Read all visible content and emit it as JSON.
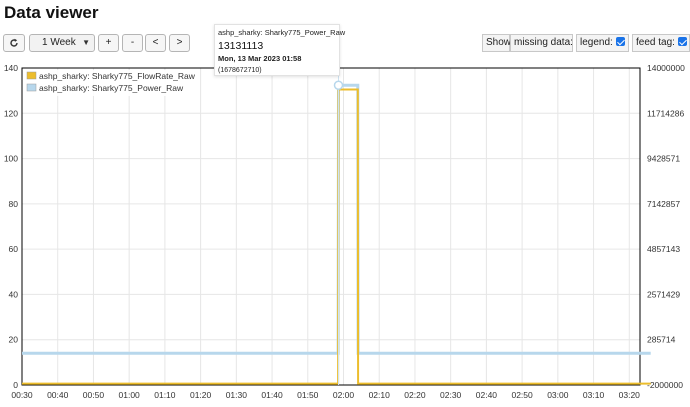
{
  "page": {
    "title": "Data viewer"
  },
  "toolbar": {
    "refresh_icon": "refresh-icon",
    "range_select": {
      "value": "1 Week"
    },
    "zoom_in_label": "+",
    "zoom_out_label": "-",
    "prev_label": "<",
    "next_label": ">"
  },
  "options": {
    "show_label": "Show",
    "missing_data_label": "missing data:",
    "missing_data_checked": false,
    "legend_label": "legend:",
    "legend_checked": true,
    "feed_tag_label": "feed tag:",
    "feed_tag_checked": true
  },
  "tooltip": {
    "series": "ashp_sharky: Sharky775_Power_Raw",
    "value": "13131113",
    "date": "Mon, 13 Mar 2023 01:58",
    "timestamp": "(1678672710)"
  },
  "colors": {
    "flow": "#ecbd2c",
    "power": "#b7d7ec",
    "grid": "#e6e6e6",
    "marker": "#b7d7ec"
  },
  "chart_data": {
    "type": "line",
    "x_ticks": [
      "00:30",
      "00:40",
      "00:50",
      "01:00",
      "01:10",
      "01:20",
      "01:30",
      "01:40",
      "01:50",
      "02:00",
      "02:10",
      "02:20",
      "02:30",
      "02:40",
      "02:50",
      "03:00",
      "03:10",
      "03:20"
    ],
    "y_left_ticks": [
      "0",
      "20",
      "40",
      "60",
      "80",
      "100",
      "120",
      "140"
    ],
    "y_left_range": [
      0,
      140
    ],
    "y_right_ticks": [
      "-2000000",
      "285714",
      "2571429",
      "4857143",
      "7142857",
      "9428571",
      "11714286",
      "14000000"
    ],
    "y_right_range": [
      -2000000,
      14000000
    ],
    "grid": true,
    "legend_position": "top-left",
    "series": [
      {
        "name": "ashp_sharky: Sharky775_FlowRate_Raw",
        "axis": "left",
        "color": "#ecbd2c",
        "points": [
          [
            0,
            0.6
          ],
          [
            10,
            0.6
          ],
          [
            20,
            0.6
          ],
          [
            30,
            0.6
          ],
          [
            40,
            0.6
          ],
          [
            50,
            0.6
          ],
          [
            60,
            0.6
          ],
          [
            70,
            0.6
          ],
          [
            80,
            0.6
          ],
          [
            88.5,
            0.6
          ],
          [
            88.6,
            130.5
          ],
          [
            94.0,
            130.5
          ],
          [
            94.1,
            0.6
          ],
          [
            100,
            0.6
          ],
          [
            110,
            0.6
          ],
          [
            120,
            0.6
          ],
          [
            130,
            0.6
          ],
          [
            140,
            0.6
          ],
          [
            150,
            0.6
          ],
          [
            160,
            0.6
          ],
          [
            170,
            0.6
          ],
          [
            176,
            0.6
          ]
        ]
      },
      {
        "name": "ashp_sharky: Sharky775_Power_Raw",
        "axis": "right",
        "color": "#b7d7ec",
        "points": [
          [
            0,
            -400000
          ],
          [
            10,
            -400000
          ],
          [
            20,
            -400000
          ],
          [
            30,
            -400000
          ],
          [
            40,
            -400000
          ],
          [
            50,
            -400000
          ],
          [
            60,
            -400000
          ],
          [
            70,
            -400000
          ],
          [
            80,
            -400000
          ],
          [
            88.5,
            -400000
          ],
          [
            88.6,
            13131113
          ],
          [
            94.0,
            13131113
          ],
          [
            94.1,
            -400000
          ],
          [
            100,
            -400000
          ],
          [
            110,
            -400000
          ],
          [
            120,
            -400000
          ],
          [
            130,
            -400000
          ],
          [
            140,
            -400000
          ],
          [
            150,
            -400000
          ],
          [
            160,
            -400000
          ],
          [
            170,
            -400000
          ],
          [
            176,
            -400000
          ]
        ]
      }
    ],
    "highlight_point": {
      "series": 1,
      "x": 88.6,
      "y": 13131113
    }
  }
}
